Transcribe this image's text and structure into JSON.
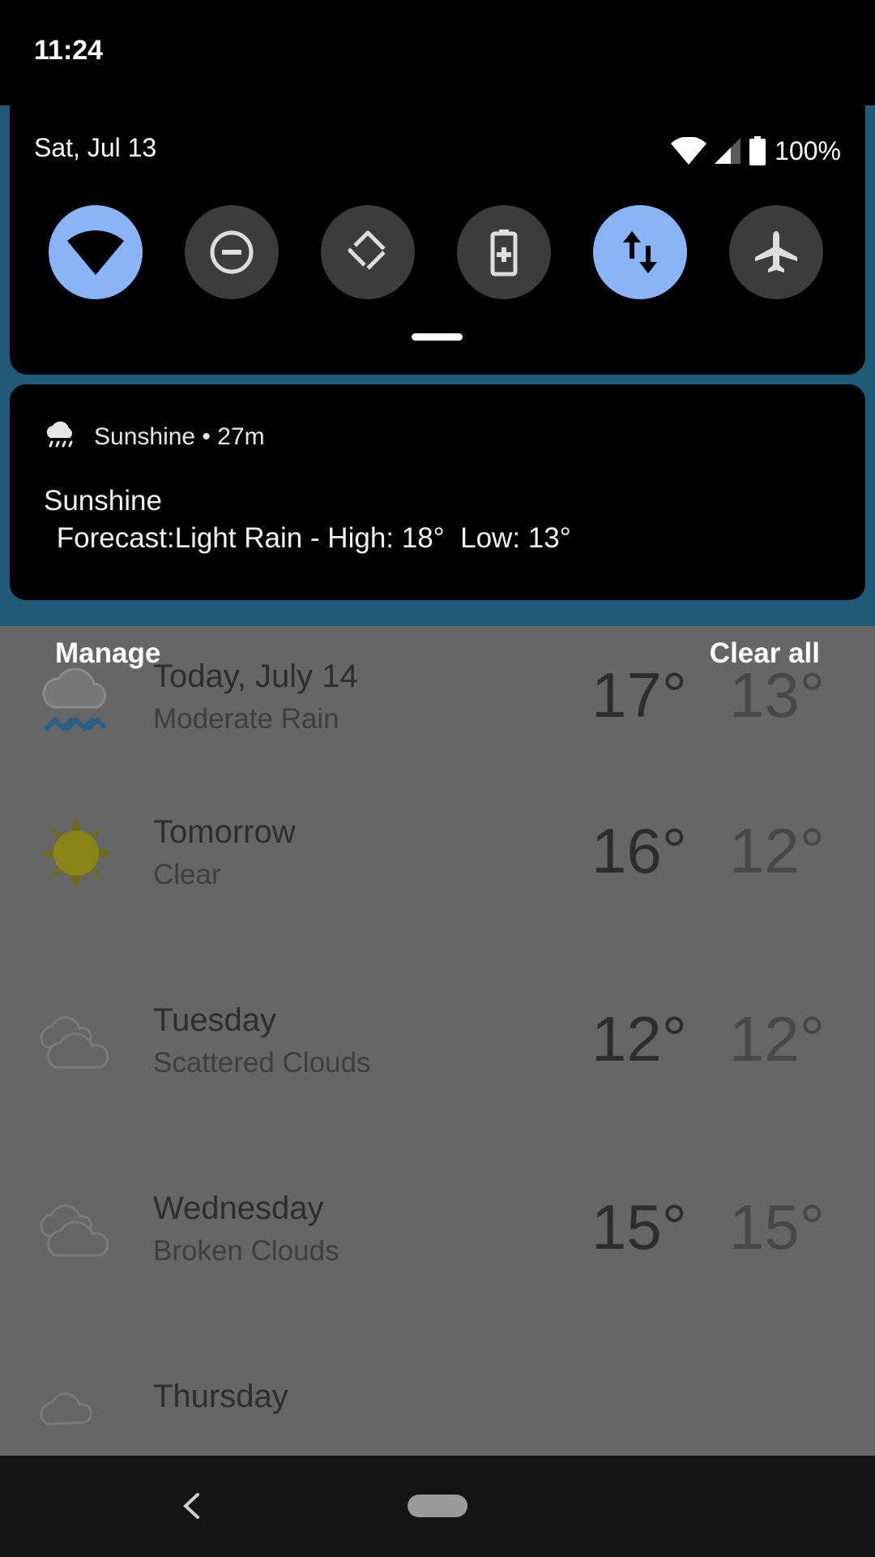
{
  "status_bar": {
    "time": "11:24"
  },
  "quick_settings": {
    "date": "Sat, Jul 13",
    "battery_percent": "100%",
    "tiles": [
      {
        "icon": "wifi-icon",
        "state": "on"
      },
      {
        "icon": "do-not-disturb-icon",
        "state": "off"
      },
      {
        "icon": "auto-rotate-icon",
        "state": "off"
      },
      {
        "icon": "battery-saver-icon",
        "state": "off"
      },
      {
        "icon": "mobile-data-icon",
        "state": "on"
      },
      {
        "icon": "airplane-mode-icon",
        "state": "off"
      }
    ]
  },
  "notification": {
    "app_icon": "rain-cloud-icon",
    "header": "Sunshine • 27m",
    "title": "Sunshine",
    "body": " Forecast:Light Rain - High: 18°  Low: 13°"
  },
  "shade_actions": {
    "manage": "Manage",
    "clear_all": "Clear all"
  },
  "forecast": [
    {
      "day": "Today, July 14",
      "desc": "Moderate Rain",
      "high": "17°",
      "low": "13°",
      "icon": "rain-icon"
    },
    {
      "day": "Tomorrow",
      "desc": "Clear",
      "high": "16°",
      "low": "12°",
      "icon": "sun-icon"
    },
    {
      "day": "Tuesday",
      "desc": "Scattered Clouds",
      "high": "12°",
      "low": "12°",
      "icon": "clouds-icon"
    },
    {
      "day": "Wednesday",
      "desc": "Broken Clouds",
      "high": "15°",
      "low": "15°",
      "icon": "clouds-icon"
    },
    {
      "day": "Thursday",
      "desc": "",
      "high": "",
      "low": "",
      "icon": "clouds-icon"
    }
  ],
  "colors": {
    "accent_tile": "#8ab4f8",
    "inactive_tile": "#3c3c3c",
    "app_header": "#1f5a77"
  }
}
